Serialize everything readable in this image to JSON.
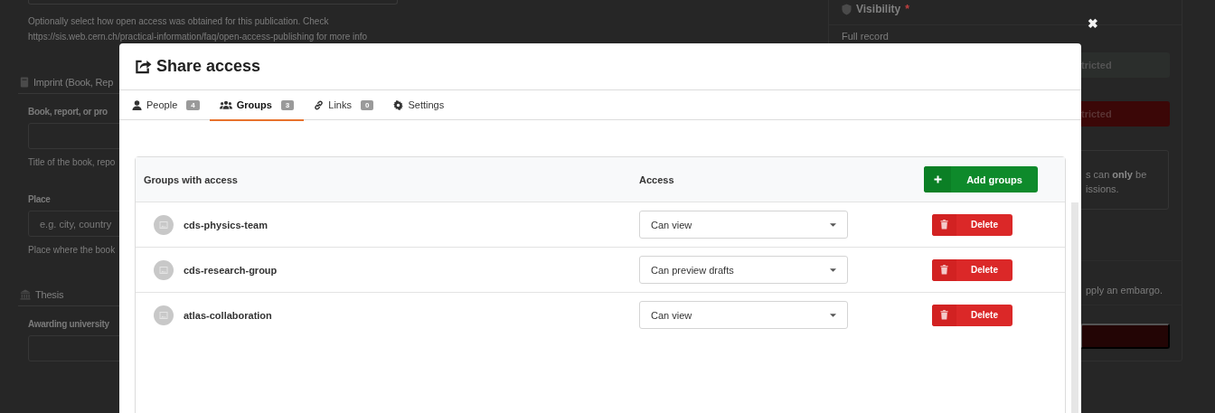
{
  "background_form": {
    "open_access_help": "Optionally select how open access was obtained for this publication. Check https://sis.web.cern.ch/practical-information/faq/open-access-publishing for more info",
    "sections": [
      {
        "kind": "book",
        "title": "Imprint (Book, Rep",
        "fields": [
          {
            "label": "Book, report, or pro",
            "help": "Title of the book, repo"
          },
          {
            "label": "Place",
            "placeholder": "e.g. city, country",
            "help": "Place where the book"
          }
        ]
      },
      {
        "kind": "bank",
        "title": "Thesis",
        "fields": [
          {
            "label": "Awarding university"
          }
        ]
      }
    ]
  },
  "visibility": {
    "title": "Visibility",
    "required_mark": "*",
    "full_record_label": "Full record",
    "options": [
      {
        "label": "tricted",
        "selected": false
      },
      {
        "label": "tricted",
        "selected": true
      }
    ],
    "notice_lines": [
      "s can **only** be",
      "issions."
    ],
    "embargo_text": "pply an embargo."
  },
  "modal": {
    "title": "Share access",
    "close": "✖",
    "tabs": [
      {
        "kind": "people",
        "label": "People",
        "count": "4",
        "selected": false
      },
      {
        "kind": "groups",
        "label": "Groups",
        "count": "3",
        "selected": true
      },
      {
        "kind": "links",
        "label": "Links",
        "count": "0",
        "selected": false
      },
      {
        "kind": "settings",
        "label": "Settings",
        "selected": false
      }
    ],
    "table": {
      "columns": [
        "Groups with access",
        "Access"
      ],
      "add_button": "Add groups",
      "rows": [
        {
          "name": "cds-physics-team",
          "access": "Can view",
          "delete": "Delete"
        },
        {
          "name": "cds-research-group",
          "access": "Can preview drafts",
          "delete": "Delete"
        },
        {
          "name": "atlas-collaboration",
          "access": "Can view",
          "delete": "Delete"
        }
      ]
    }
  }
}
